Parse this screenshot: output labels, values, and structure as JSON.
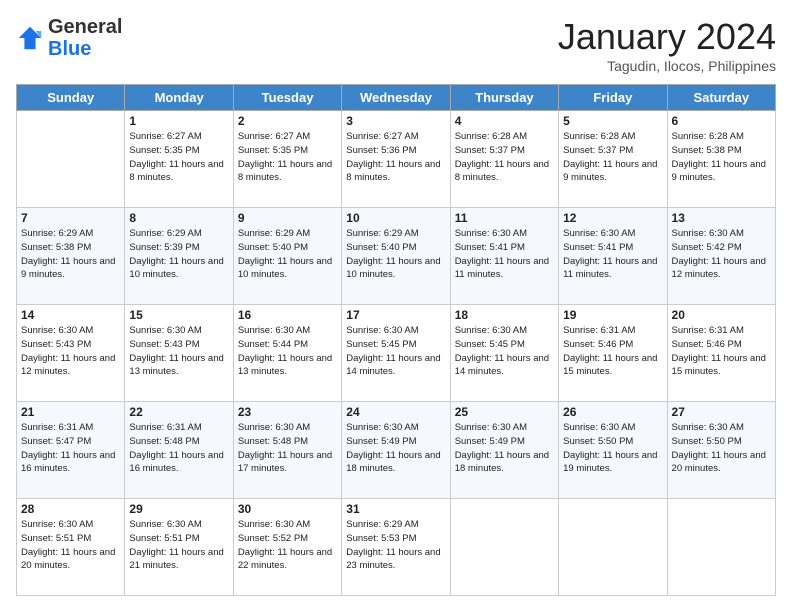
{
  "header": {
    "logo": {
      "general": "General",
      "blue": "Blue"
    },
    "title": "January 2024",
    "subtitle": "Tagudin, Ilocos, Philippines"
  },
  "weekdays": [
    "Sunday",
    "Monday",
    "Tuesday",
    "Wednesday",
    "Thursday",
    "Friday",
    "Saturday"
  ],
  "weeks": [
    [
      {
        "day": "",
        "sunrise": "",
        "sunset": "",
        "daylight": ""
      },
      {
        "day": "1",
        "sunrise": "Sunrise: 6:27 AM",
        "sunset": "Sunset: 5:35 PM",
        "daylight": "Daylight: 11 hours and 8 minutes."
      },
      {
        "day": "2",
        "sunrise": "Sunrise: 6:27 AM",
        "sunset": "Sunset: 5:35 PM",
        "daylight": "Daylight: 11 hours and 8 minutes."
      },
      {
        "day": "3",
        "sunrise": "Sunrise: 6:27 AM",
        "sunset": "Sunset: 5:36 PM",
        "daylight": "Daylight: 11 hours and 8 minutes."
      },
      {
        "day": "4",
        "sunrise": "Sunrise: 6:28 AM",
        "sunset": "Sunset: 5:37 PM",
        "daylight": "Daylight: 11 hours and 8 minutes."
      },
      {
        "day": "5",
        "sunrise": "Sunrise: 6:28 AM",
        "sunset": "Sunset: 5:37 PM",
        "daylight": "Daylight: 11 hours and 9 minutes."
      },
      {
        "day": "6",
        "sunrise": "Sunrise: 6:28 AM",
        "sunset": "Sunset: 5:38 PM",
        "daylight": "Daylight: 11 hours and 9 minutes."
      }
    ],
    [
      {
        "day": "7",
        "sunrise": "Sunrise: 6:29 AM",
        "sunset": "Sunset: 5:38 PM",
        "daylight": "Daylight: 11 hours and 9 minutes."
      },
      {
        "day": "8",
        "sunrise": "Sunrise: 6:29 AM",
        "sunset": "Sunset: 5:39 PM",
        "daylight": "Daylight: 11 hours and 10 minutes."
      },
      {
        "day": "9",
        "sunrise": "Sunrise: 6:29 AM",
        "sunset": "Sunset: 5:40 PM",
        "daylight": "Daylight: 11 hours and 10 minutes."
      },
      {
        "day": "10",
        "sunrise": "Sunrise: 6:29 AM",
        "sunset": "Sunset: 5:40 PM",
        "daylight": "Daylight: 11 hours and 10 minutes."
      },
      {
        "day": "11",
        "sunrise": "Sunrise: 6:30 AM",
        "sunset": "Sunset: 5:41 PM",
        "daylight": "Daylight: 11 hours and 11 minutes."
      },
      {
        "day": "12",
        "sunrise": "Sunrise: 6:30 AM",
        "sunset": "Sunset: 5:41 PM",
        "daylight": "Daylight: 11 hours and 11 minutes."
      },
      {
        "day": "13",
        "sunrise": "Sunrise: 6:30 AM",
        "sunset": "Sunset: 5:42 PM",
        "daylight": "Daylight: 11 hours and 12 minutes."
      }
    ],
    [
      {
        "day": "14",
        "sunrise": "Sunrise: 6:30 AM",
        "sunset": "Sunset: 5:43 PM",
        "daylight": "Daylight: 11 hours and 12 minutes."
      },
      {
        "day": "15",
        "sunrise": "Sunrise: 6:30 AM",
        "sunset": "Sunset: 5:43 PM",
        "daylight": "Daylight: 11 hours and 13 minutes."
      },
      {
        "day": "16",
        "sunrise": "Sunrise: 6:30 AM",
        "sunset": "Sunset: 5:44 PM",
        "daylight": "Daylight: 11 hours and 13 minutes."
      },
      {
        "day": "17",
        "sunrise": "Sunrise: 6:30 AM",
        "sunset": "Sunset: 5:45 PM",
        "daylight": "Daylight: 11 hours and 14 minutes."
      },
      {
        "day": "18",
        "sunrise": "Sunrise: 6:30 AM",
        "sunset": "Sunset: 5:45 PM",
        "daylight": "Daylight: 11 hours and 14 minutes."
      },
      {
        "day": "19",
        "sunrise": "Sunrise: 6:31 AM",
        "sunset": "Sunset: 5:46 PM",
        "daylight": "Daylight: 11 hours and 15 minutes."
      },
      {
        "day": "20",
        "sunrise": "Sunrise: 6:31 AM",
        "sunset": "Sunset: 5:46 PM",
        "daylight": "Daylight: 11 hours and 15 minutes."
      }
    ],
    [
      {
        "day": "21",
        "sunrise": "Sunrise: 6:31 AM",
        "sunset": "Sunset: 5:47 PM",
        "daylight": "Daylight: 11 hours and 16 minutes."
      },
      {
        "day": "22",
        "sunrise": "Sunrise: 6:31 AM",
        "sunset": "Sunset: 5:48 PM",
        "daylight": "Daylight: 11 hours and 16 minutes."
      },
      {
        "day": "23",
        "sunrise": "Sunrise: 6:30 AM",
        "sunset": "Sunset: 5:48 PM",
        "daylight": "Daylight: 11 hours and 17 minutes."
      },
      {
        "day": "24",
        "sunrise": "Sunrise: 6:30 AM",
        "sunset": "Sunset: 5:49 PM",
        "daylight": "Daylight: 11 hours and 18 minutes."
      },
      {
        "day": "25",
        "sunrise": "Sunrise: 6:30 AM",
        "sunset": "Sunset: 5:49 PM",
        "daylight": "Daylight: 11 hours and 18 minutes."
      },
      {
        "day": "26",
        "sunrise": "Sunrise: 6:30 AM",
        "sunset": "Sunset: 5:50 PM",
        "daylight": "Daylight: 11 hours and 19 minutes."
      },
      {
        "day": "27",
        "sunrise": "Sunrise: 6:30 AM",
        "sunset": "Sunset: 5:50 PM",
        "daylight": "Daylight: 11 hours and 20 minutes."
      }
    ],
    [
      {
        "day": "28",
        "sunrise": "Sunrise: 6:30 AM",
        "sunset": "Sunset: 5:51 PM",
        "daylight": "Daylight: 11 hours and 20 minutes."
      },
      {
        "day": "29",
        "sunrise": "Sunrise: 6:30 AM",
        "sunset": "Sunset: 5:51 PM",
        "daylight": "Daylight: 11 hours and 21 minutes."
      },
      {
        "day": "30",
        "sunrise": "Sunrise: 6:30 AM",
        "sunset": "Sunset: 5:52 PM",
        "daylight": "Daylight: 11 hours and 22 minutes."
      },
      {
        "day": "31",
        "sunrise": "Sunrise: 6:29 AM",
        "sunset": "Sunset: 5:53 PM",
        "daylight": "Daylight: 11 hours and 23 minutes."
      },
      {
        "day": "",
        "sunrise": "",
        "sunset": "",
        "daylight": ""
      },
      {
        "day": "",
        "sunrise": "",
        "sunset": "",
        "daylight": ""
      },
      {
        "day": "",
        "sunrise": "",
        "sunset": "",
        "daylight": ""
      }
    ]
  ]
}
